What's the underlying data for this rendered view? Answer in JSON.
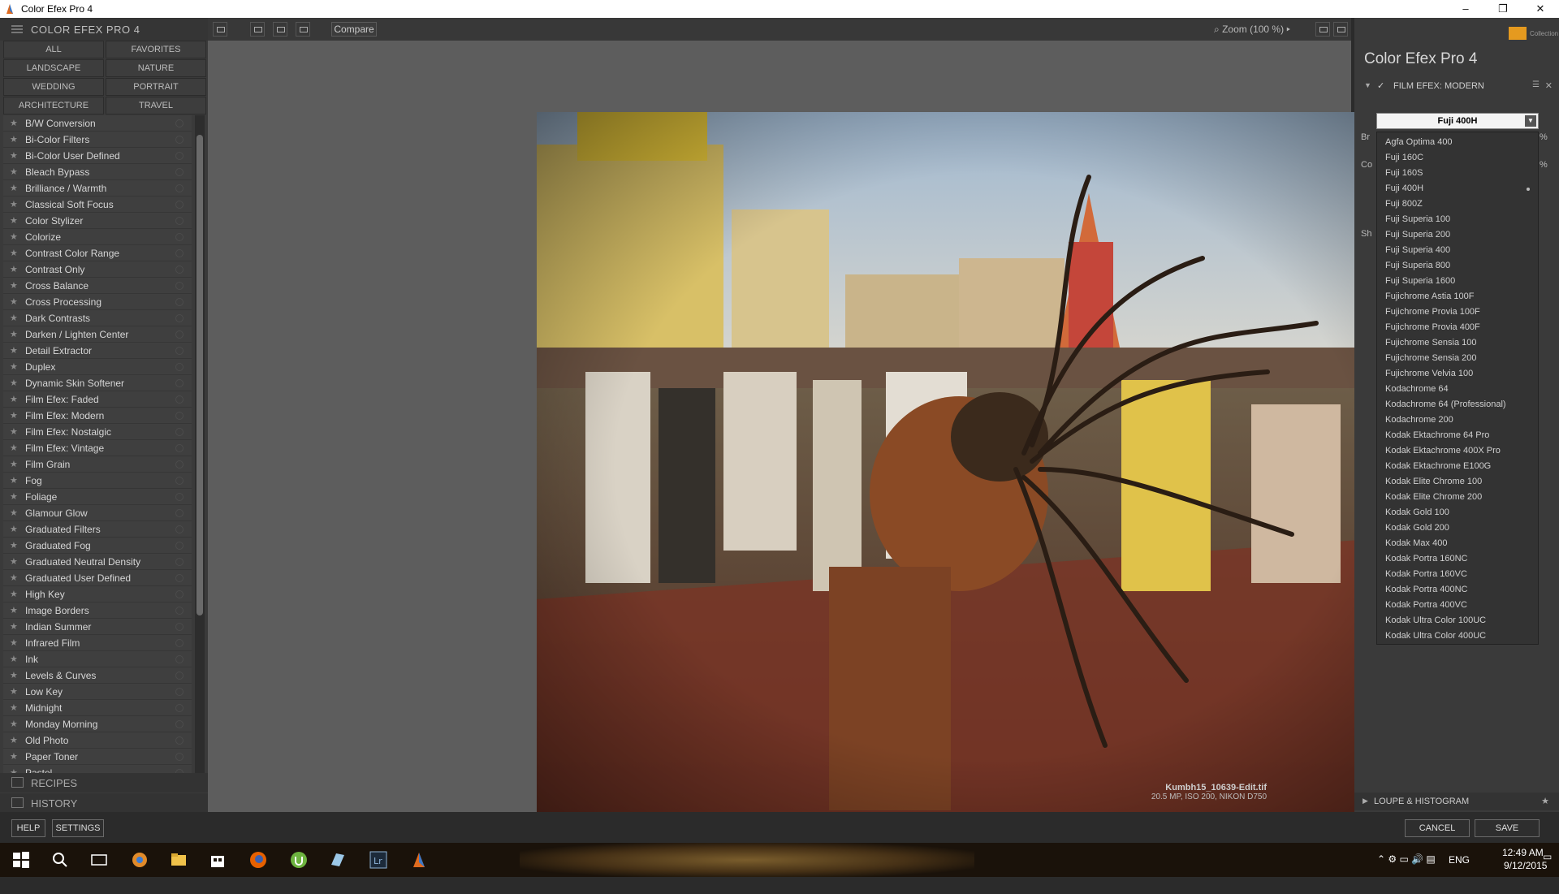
{
  "window": {
    "title": "Color Efex Pro 4",
    "controls": [
      "–",
      "❐",
      "✕"
    ]
  },
  "left_panel": {
    "header": "COLOR EFEX PRO 4",
    "categories": [
      "ALL",
      "FAVORITES",
      "LANDSCAPE",
      "NATURE",
      "WEDDING",
      "PORTRAIT",
      "ARCHITECTURE",
      "TRAVEL"
    ],
    "filters": [
      "B/W Conversion",
      "Bi-Color Filters",
      "Bi-Color User Defined",
      "Bleach Bypass",
      "Brilliance / Warmth",
      "Classical Soft Focus",
      "Color Stylizer",
      "Colorize",
      "Contrast Color Range",
      "Contrast Only",
      "Cross Balance",
      "Cross Processing",
      "Dark Contrasts",
      "Darken / Lighten Center",
      "Detail Extractor",
      "Duplex",
      "Dynamic Skin Softener",
      "Film Efex: Faded",
      "Film Efex: Modern",
      "Film Efex: Nostalgic",
      "Film Efex: Vintage",
      "Film Grain",
      "Fog",
      "Foliage",
      "Glamour Glow",
      "Graduated Filters",
      "Graduated Fog",
      "Graduated Neutral Density",
      "Graduated User Defined",
      "High Key",
      "Image Borders",
      "Indian Summer",
      "Infrared Film",
      "Ink",
      "Levels & Curves",
      "Low Key",
      "Midnight",
      "Monday Morning",
      "Old Photo",
      "Paper Toner",
      "Pastel"
    ],
    "recipes": "RECIPES",
    "history": "HISTORY"
  },
  "toolbar": {
    "compare": "Compare",
    "zoom": "Zoom (100 %)"
  },
  "image": {
    "filename": "Kumbh15_10639-Edit.tif",
    "info": "20.5 MP, ISO 200, NIKON D750"
  },
  "bottom": {
    "help": "HELP",
    "settings": "SETTINGS",
    "cancel": "CANCEL",
    "save": "SAVE"
  },
  "right_panel": {
    "title": "Color Efex Pro",
    "title_num": "4",
    "collection": "Collection",
    "section": "FILM EFEX: MODERN",
    "dropdown_value": "Fuji 400H",
    "partial_labels": [
      "Br",
      "Co",
      "Sh"
    ],
    "partial_values": [
      "%",
      "%"
    ],
    "films": [
      "Agfa Optima 400",
      "Fuji 160C",
      "Fuji 160S",
      "Fuji 400H",
      "Fuji 800Z",
      "Fuji Superia 100",
      "Fuji Superia 200",
      "Fuji Superia 400",
      "Fuji Superia 800",
      "Fuji Superia 1600",
      "Fujichrome Astia 100F",
      "Fujichrome Provia 100F",
      "Fujichrome Provia 400F",
      "Fujichrome Sensia 100",
      "Fujichrome Sensia 200",
      "Fujichrome Velvia 100",
      "Kodachrome 64",
      "Kodachrome 64 (Professional)",
      "Kodachrome 200",
      "Kodak Ektachrome 64 Pro",
      "Kodak Ektachrome 400X Pro",
      "Kodak Ektachrome E100G",
      "Kodak Elite Chrome 100",
      "Kodak Elite Chrome 200",
      "Kodak Gold 100",
      "Kodak Gold 200",
      "Kodak Max 400",
      "Kodak Portra 160NC",
      "Kodak Portra 160VC",
      "Kodak Portra 400NC",
      "Kodak Portra 400VC",
      "Kodak Ultra Color 100UC",
      "Kodak Ultra Color 400UC"
    ],
    "loupe": "LOUPE & HISTOGRAM"
  },
  "taskbar": {
    "lang": "ENG",
    "time": "12:49 AM",
    "date": "9/12/2015"
  }
}
